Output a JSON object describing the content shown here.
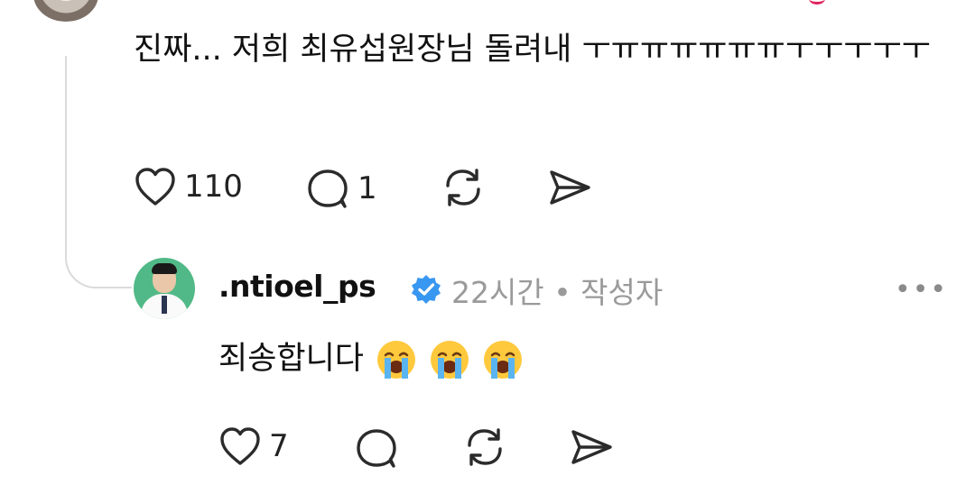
{
  "parent_comment": {
    "text": "진짜... 저희 최유섭원장님 돌려내 ㅜㅠㅠㅠㅠㅠㅠㅜㅜㅜㅜㅜ",
    "likes": "110",
    "replies": "1"
  },
  "reply": {
    "username": ".ntioel_ps",
    "time_author": "22시간 • 작성자",
    "text": "죄송합니다",
    "emojis": [
      "crying-face",
      "crying-face",
      "crying-face"
    ],
    "likes": "7",
    "more_label": "•••"
  },
  "colors": {
    "verified": "#3897f0",
    "meta": "#9a9a9a",
    "thread_line": "#dadada",
    "avatar_bg": "#51b987"
  }
}
